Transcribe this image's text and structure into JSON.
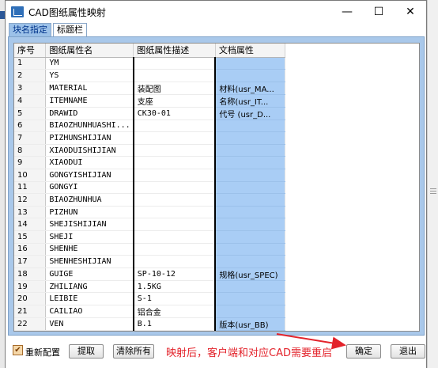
{
  "window": {
    "title": "CAD图纸属性映射",
    "minimize_glyph": "—",
    "maximize_glyph": "☐",
    "close_glyph": "✕"
  },
  "tabs": [
    {
      "label": "块名指定",
      "active": false
    },
    {
      "label": "标题栏",
      "active": true
    }
  ],
  "table": {
    "headers": [
      "序号",
      "图纸属性名",
      "图纸属性描述",
      "文档属性"
    ],
    "rows": [
      {
        "no": "1",
        "name": "YM",
        "desc": "",
        "prop": ""
      },
      {
        "no": "2",
        "name": "YS",
        "desc": "",
        "prop": ""
      },
      {
        "no": "3",
        "name": "MATERIAL",
        "desc": "装配图",
        "prop": "材料(usr_MA..."
      },
      {
        "no": "4",
        "name": "ITEMNAME",
        "desc": "支座",
        "prop": "名称(usr_IT..."
      },
      {
        "no": "5",
        "name": "DRAWID",
        "desc": "CK30-01",
        "prop": "代号 (usr_D..."
      },
      {
        "no": "6",
        "name": "BIAOZHUNHUASHI...",
        "desc": "",
        "prop": ""
      },
      {
        "no": "7",
        "name": "PIZHUNSHIJIAN",
        "desc": "",
        "prop": ""
      },
      {
        "no": "8",
        "name": "XIAODUISHIJIAN",
        "desc": "",
        "prop": ""
      },
      {
        "no": "9",
        "name": "XIAODUI",
        "desc": "",
        "prop": ""
      },
      {
        "no": "10",
        "name": "GONGYISHIJIAN",
        "desc": "",
        "prop": ""
      },
      {
        "no": "11",
        "name": "GONGYI",
        "desc": "",
        "prop": ""
      },
      {
        "no": "12",
        "name": "BIAOZHUNHUA",
        "desc": "",
        "prop": ""
      },
      {
        "no": "13",
        "name": "PIZHUN",
        "desc": "",
        "prop": ""
      },
      {
        "no": "14",
        "name": "SHEJISHIJIAN",
        "desc": "",
        "prop": ""
      },
      {
        "no": "15",
        "name": "SHEJI",
        "desc": "",
        "prop": ""
      },
      {
        "no": "16",
        "name": "SHENHE",
        "desc": "",
        "prop": ""
      },
      {
        "no": "17",
        "name": "SHENHESHIJIAN",
        "desc": "",
        "prop": ""
      },
      {
        "no": "18",
        "name": "GUIGE",
        "desc": "SP-10-12",
        "prop": "规格(usr_SPEC)"
      },
      {
        "no": "19",
        "name": "ZHILIANG",
        "desc": "1.5KG",
        "prop": ""
      },
      {
        "no": "20",
        "name": "LEIBIE",
        "desc": "S-1",
        "prop": ""
      },
      {
        "no": "21",
        "name": "CAILIAO",
        "desc": "铝合金",
        "prop": ""
      },
      {
        "no": "22",
        "name": "VEN",
        "desc": "B.1",
        "prop": "版本(usr_BB)"
      }
    ]
  },
  "bottom": {
    "checkbox_label": "重新配置",
    "checkbox_checked": true,
    "check_glyph": "✔",
    "fetch_label": "提取",
    "clear_label": "清除所有",
    "annotation": "映射后，客户端和对应CAD需要重启",
    "ok_label": "确定",
    "exit_label": "退出"
  },
  "colors": {
    "annotation": "#e3232b",
    "property_column": "#a9cdf5",
    "panel": "#a9c8ea"
  }
}
